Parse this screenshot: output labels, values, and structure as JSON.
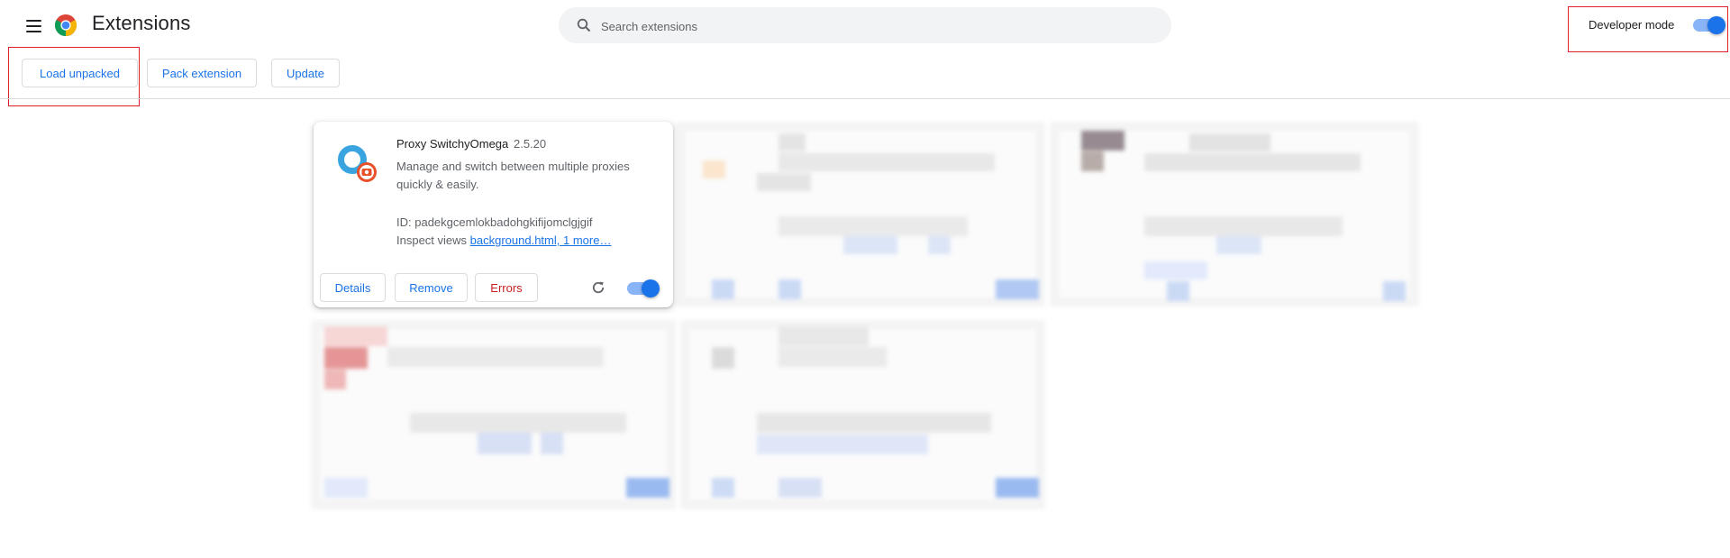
{
  "header": {
    "title": "Extensions",
    "menu_icon": "hamburger-menu-icon",
    "logo_icon": "chrome-logo-icon",
    "search": {
      "placeholder": "Search extensions",
      "value": "",
      "icon": "search-icon"
    },
    "developer_mode": {
      "label": "Developer mode",
      "enabled": true
    }
  },
  "toolbar": {
    "load_unpacked": "Load unpacked",
    "pack_extension": "Pack extension",
    "update": "Update"
  },
  "extension": {
    "name": "Proxy SwitchyOmega",
    "version": "2.5.20",
    "description": "Manage and switch between multiple proxies quickly & easily.",
    "id_label": "ID: ",
    "id": "padekgcemlokbadohgkifijomclgjgif",
    "inspect_label": "Inspect views ",
    "inspect_link": "background.html, 1 more…",
    "buttons": {
      "details": "Details",
      "remove": "Remove",
      "errors": "Errors"
    },
    "enabled": true
  },
  "colors": {
    "accent": "#1a73e8",
    "error": "#c5221f",
    "highlight": "#e0202a",
    "toggle_track": "#8ab4f8"
  }
}
